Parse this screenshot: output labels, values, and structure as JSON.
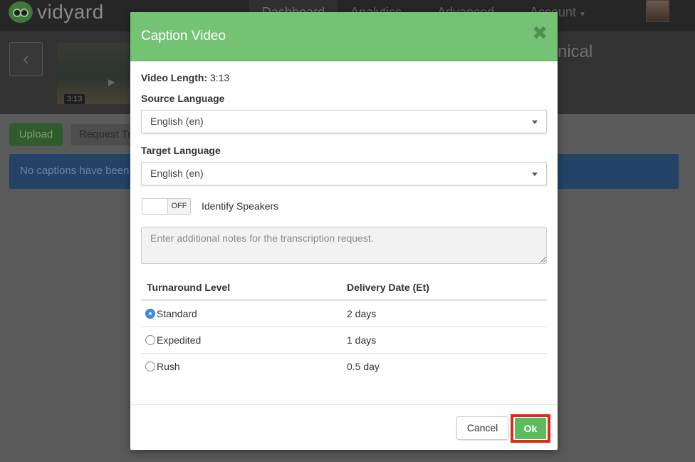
{
  "app": {
    "logo_text": "vidyard",
    "nav": [
      {
        "label": "Dashboard"
      },
      {
        "label": "Analytics"
      },
      {
        "label": "Advanced"
      },
      {
        "label": "Account"
      }
    ]
  },
  "video": {
    "duration": "3:13",
    "title_fragment": "nical"
  },
  "page_actions": {
    "upload_label": "Upload",
    "request_label": "Request Tr",
    "alert_text": "No captions have been"
  },
  "modal": {
    "title": "Caption Video",
    "close_glyph": "✖",
    "video_length_label": "Video Length:",
    "video_length_value": "3:13",
    "source_language_label": "Source Language",
    "source_language_value": "English (en)",
    "target_language_label": "Target Language",
    "target_language_value": "English (en)",
    "toggle_state": "OFF",
    "identify_speakers_label": "Identify Speakers",
    "notes_placeholder": "Enter additional notes for the transcription request.",
    "table": {
      "headers": [
        "Turnaround Level",
        "Delivery Date (Et)"
      ],
      "rows": [
        {
          "level": "Standard",
          "delivery": "2 days",
          "selected": true
        },
        {
          "level": "Expedited",
          "delivery": "1 days",
          "selected": false
        },
        {
          "level": "Rush",
          "delivery": "0.5 day",
          "selected": false
        }
      ]
    },
    "cancel_label": "Cancel",
    "ok_label": "Ok"
  },
  "colors": {
    "header_green": "#74c375",
    "ok_green": "#5cbc5d",
    "highlight_red": "#e02b1c",
    "radio_blue": "#3b8ee6"
  }
}
